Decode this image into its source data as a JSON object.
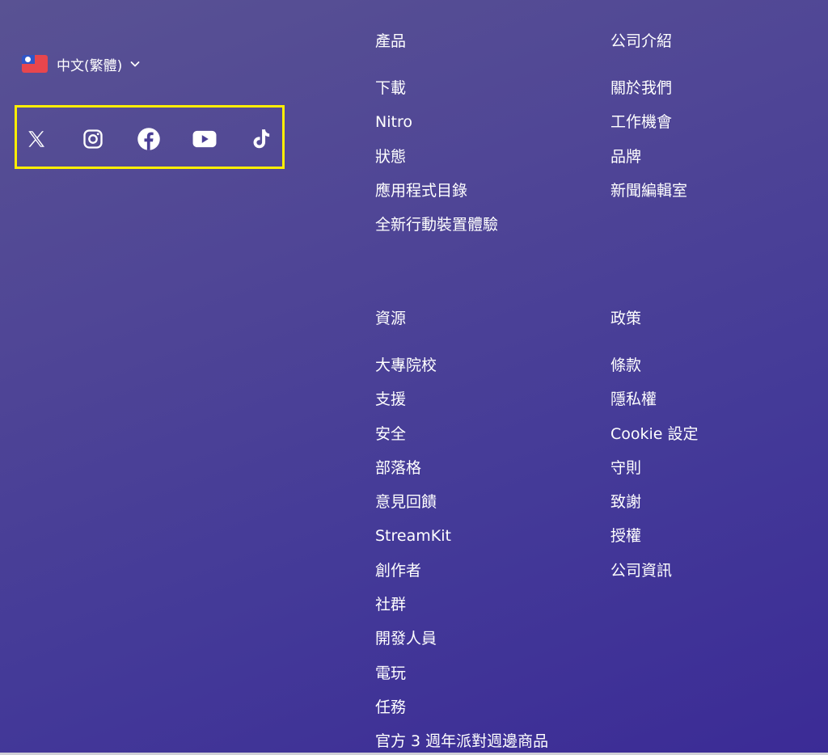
{
  "language": {
    "label": "中文(繁體)",
    "flag_icon": "taiwan-flag-icon",
    "chevron_icon": "chevron-down-icon"
  },
  "social": {
    "highlight_color": "#ffee00",
    "icons": [
      "x-twitter-icon",
      "instagram-icon",
      "facebook-icon",
      "youtube-icon",
      "tiktok-icon"
    ]
  },
  "columns": {
    "products": {
      "heading": "產品",
      "links": [
        "下載",
        "Nitro",
        "狀態",
        "應用程式目錄",
        "全新行動裝置體驗"
      ]
    },
    "company": {
      "heading": "公司介紹",
      "links": [
        "關於我們",
        "工作機會",
        "品牌",
        "新聞編輯室"
      ]
    },
    "resources": {
      "heading": "資源",
      "links": [
        "大專院校",
        "支援",
        "安全",
        "部落格",
        "意見回饋",
        "StreamKit",
        "創作者",
        "社群",
        "開發人員",
        "電玩",
        "任務",
        "官方 3 週年派對週邊商品"
      ]
    },
    "policies": {
      "heading": "政策",
      "links": [
        "條款",
        "隱私權",
        "Cookie 設定",
        "守則",
        "致謝",
        "授權",
        "公司資訊"
      ]
    }
  },
  "colors": {
    "background_start": "#595293",
    "background_end": "#3b2b96",
    "text": "#ffffff"
  }
}
